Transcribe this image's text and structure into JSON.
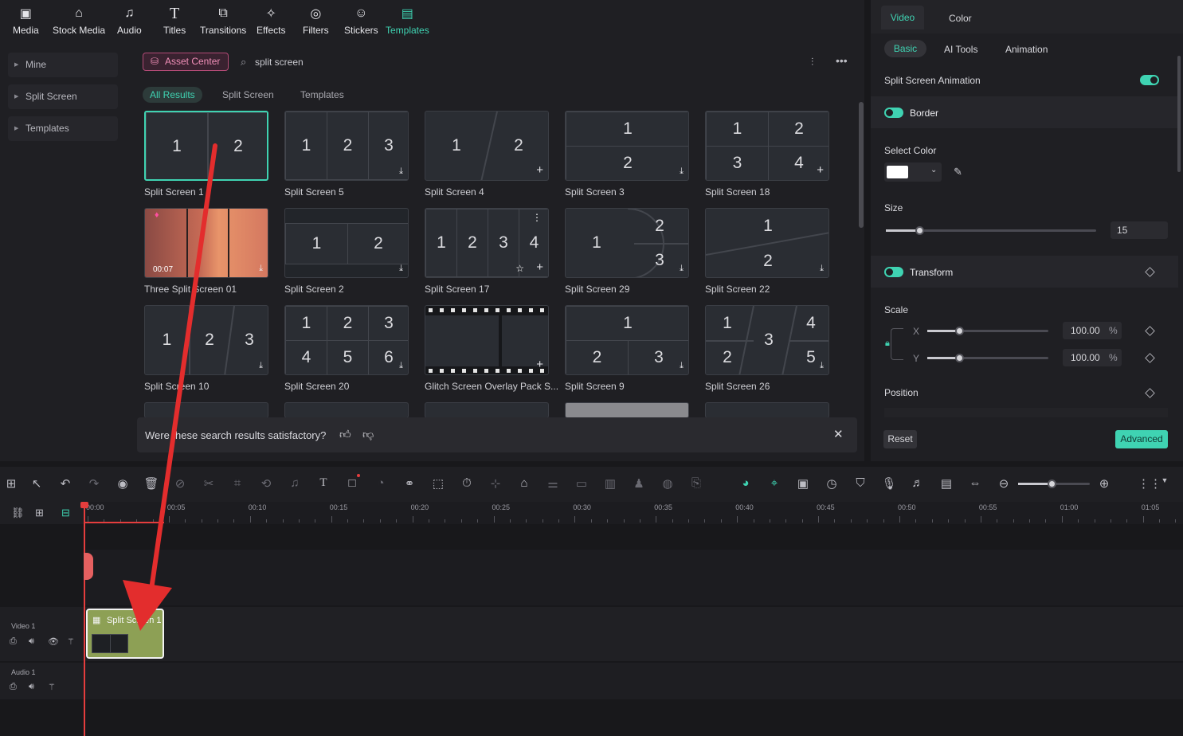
{
  "toolbar": {
    "items": [
      {
        "label": "Media",
        "icon": "media-icon"
      },
      {
        "label": "Stock Media",
        "icon": "stock-media-icon"
      },
      {
        "label": "Audio",
        "icon": "audio-icon"
      },
      {
        "label": "Titles",
        "icon": "titles-icon"
      },
      {
        "label": "Transitions",
        "icon": "transitions-icon"
      },
      {
        "label": "Effects",
        "icon": "effects-icon"
      },
      {
        "label": "Filters",
        "icon": "filters-icon"
      },
      {
        "label": "Stickers",
        "icon": "stickers-icon"
      },
      {
        "label": "Templates",
        "icon": "templates-icon"
      }
    ],
    "active": "Templates"
  },
  "sidebar": {
    "items": [
      {
        "label": "Mine"
      },
      {
        "label": "Split Screen"
      },
      {
        "label": "Templates"
      }
    ]
  },
  "library": {
    "asset_center": "Asset Center",
    "search_value": "split screen",
    "filters": [
      {
        "label": "All Results",
        "active": true
      },
      {
        "label": "Split Screen"
      },
      {
        "label": "Templates"
      }
    ],
    "items": [
      {
        "name": "Split Screen 1"
      },
      {
        "name": "Split Screen 5"
      },
      {
        "name": "Split Screen 4"
      },
      {
        "name": "Split Screen 3"
      },
      {
        "name": "Split Screen 18"
      },
      {
        "name": "Three Split Screen 01",
        "duration": "00:07"
      },
      {
        "name": "Split Screen 2"
      },
      {
        "name": "Split Screen 17"
      },
      {
        "name": "Split Screen 29"
      },
      {
        "name": "Split Screen 22"
      },
      {
        "name": "Split Screen 10"
      },
      {
        "name": "Split Screen 20"
      },
      {
        "name": "Glitch Screen Overlay Pack S..."
      },
      {
        "name": "Split Screen 9"
      },
      {
        "name": "Split Screen 26"
      }
    ],
    "feedback": "Were these search results satisfactory?"
  },
  "right_panel": {
    "tabs": [
      {
        "label": "Video",
        "active": true
      },
      {
        "label": "Color"
      }
    ],
    "subtabs": [
      {
        "label": "Basic",
        "active": true
      },
      {
        "label": "AI Tools"
      },
      {
        "label": "Animation"
      }
    ],
    "split_anim": "Split Screen Animation",
    "border": "Border",
    "select_color": "Select Color",
    "border_color": "#ffffff",
    "size_label": "Size",
    "size_value": "15",
    "transform": "Transform",
    "scale": "Scale",
    "scale_x_label": "X",
    "scale_y_label": "Y",
    "scale_x": "100.00",
    "scale_y": "100.00",
    "percent": "%",
    "position": "Position",
    "reset": "Reset",
    "advanced": "Advanced"
  },
  "timeline": {
    "ruler": [
      "00:00",
      "00:05",
      "00:10",
      "00:15",
      "00:20",
      "00:25",
      "00:30",
      "00:35",
      "00:40",
      "00:45",
      "00:50",
      "00:55",
      "01:00",
      "01:05"
    ],
    "tracks": [
      {
        "name": "Video 1"
      },
      {
        "name": "Audio 1"
      }
    ],
    "clip_name": "Split Screen 1"
  },
  "colors": {
    "accent": "#3fd3b2",
    "playhead": "#e53d3d",
    "clip": "#8da055",
    "arrow": "#e32d2d"
  }
}
